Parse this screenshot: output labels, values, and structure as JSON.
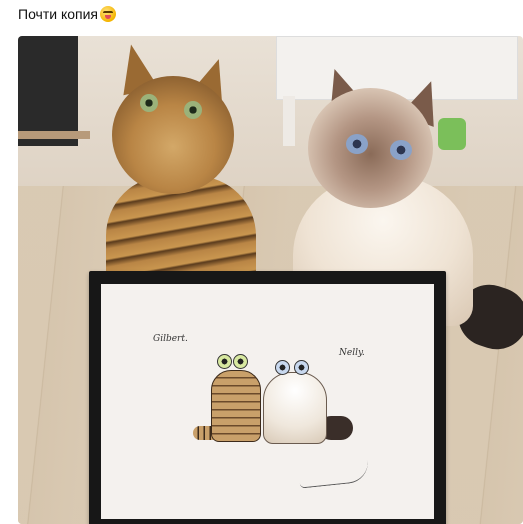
{
  "post": {
    "caption": "Почти копия",
    "emoji_icon": "grinning-face-with-tongue-icon"
  },
  "photo": {
    "drawing_labels": {
      "left_cat_name": "Gilbert.",
      "right_cat_name": "Nelly."
    }
  }
}
